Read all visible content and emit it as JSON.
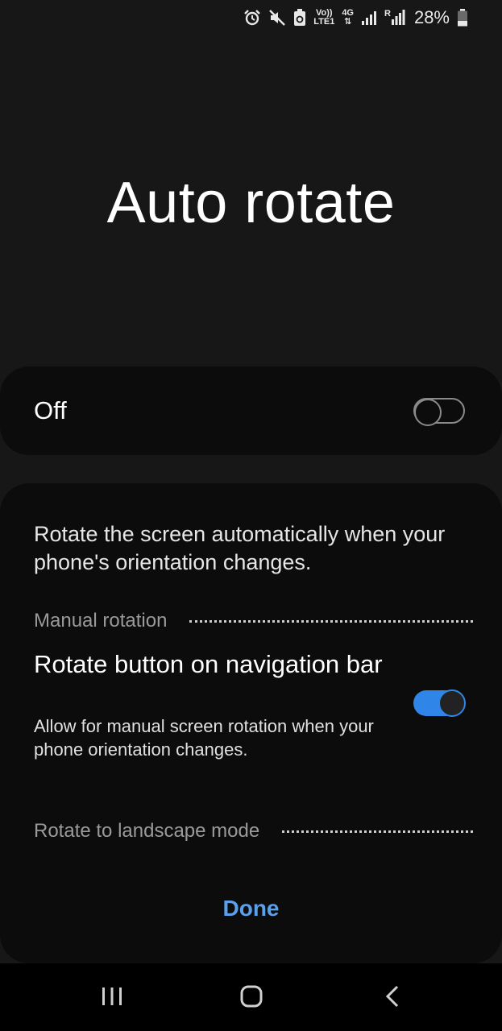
{
  "status_bar": {
    "icons": [
      "alarm-icon",
      "mute-icon",
      "data-saver-icon",
      "volte-icon",
      "4g-icon",
      "signal-icon",
      "roaming-signal-icon",
      "battery-icon"
    ],
    "volte_top": "Vo))",
    "volte_bottom": "LTE1",
    "net_type": "4G",
    "roaming": "R",
    "battery_percent": "28%"
  },
  "title": "Auto rotate",
  "master": {
    "label": "Off",
    "enabled": false
  },
  "description": "Rotate the screen automatically when your phone's orientation changes.",
  "manual_rotation": {
    "section_label": "Manual rotation",
    "setting_title": "Rotate button on navigation bar",
    "setting_subtitle": "Allow for manual screen rotation when your phone orientation changes.",
    "enabled": true
  },
  "landscape": {
    "section_label": "Rotate to landscape mode"
  },
  "done_label": "Done",
  "nav": [
    "recents-icon",
    "home-icon",
    "back-icon"
  ],
  "colors": {
    "accent": "#2f86e8",
    "done_text": "#5aa0ea",
    "card_bg": "#0c0c0c",
    "page_bg": "#171717"
  }
}
